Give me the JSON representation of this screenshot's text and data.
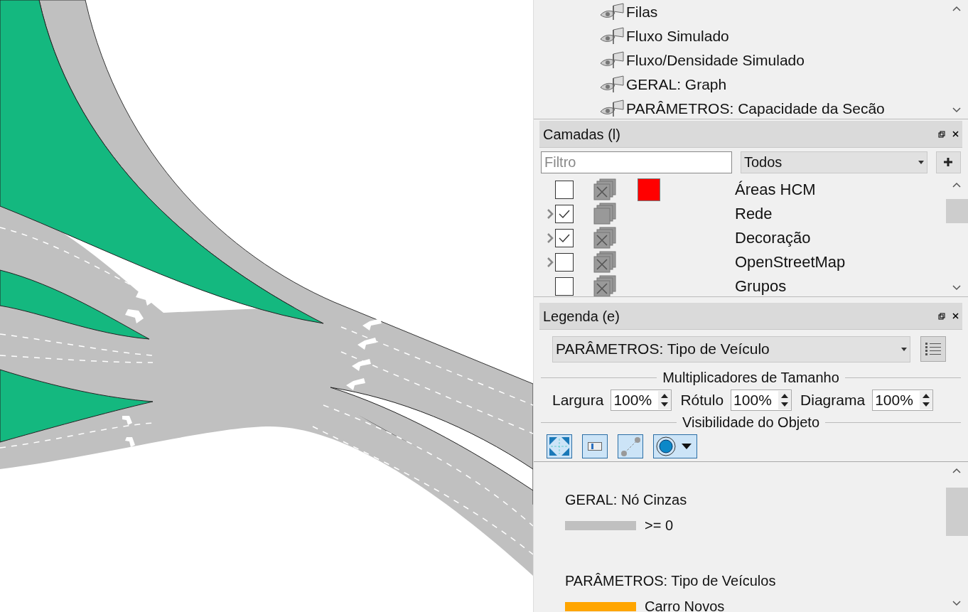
{
  "tree_items": [
    "Filas",
    "Fluxo Simulado",
    "Fluxo/Densidade Simulado",
    "GERAL: Graph",
    "PARÂMETROS: Capacidade da Secão"
  ],
  "layers_panel": {
    "title": "Camadas (l)",
    "filter_placeholder": "Filtro",
    "filter_choice": "Todos",
    "layers": [
      {
        "name": "Áreas HCM",
        "checked": false,
        "expandable": false,
        "hidden": true,
        "color": "#ff0000"
      },
      {
        "name": "Rede",
        "checked": true,
        "expandable": true,
        "hidden": false
      },
      {
        "name": "Decoração",
        "checked": true,
        "expandable": true,
        "hidden": true
      },
      {
        "name": "OpenStreetMap",
        "checked": false,
        "expandable": true,
        "hidden": true
      },
      {
        "name": "Grupos",
        "checked": false,
        "expandable": false,
        "hidden": true
      }
    ]
  },
  "legend_panel": {
    "title": "Legenda (e)",
    "selected_view": "PARÂMETROS: Tipo de Veículo",
    "size_title": "Multiplicadores de Tamanho",
    "multipliers": [
      {
        "label": "Largura",
        "value": "100%"
      },
      {
        "label": "Rótulo",
        "value": "100%"
      },
      {
        "label": "Diagrama",
        "value": "100%"
      }
    ],
    "visibility_title": "Visibilidade do Objeto",
    "sections": [
      {
        "title": "GERAL: Nó Cinzas",
        "items": [
          {
            "label": ">= 0",
            "color": "#c0c0c0"
          }
        ]
      },
      {
        "title": "PARÂMETROS: Tipo de Veículos",
        "items": [
          {
            "label": "Carro Novos",
            "color": "#ffa500"
          }
        ]
      }
    ]
  }
}
